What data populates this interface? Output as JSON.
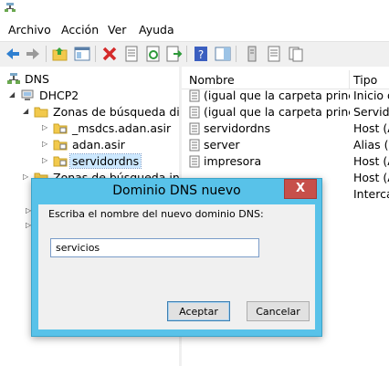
{
  "menu": [
    "Archivo",
    "Acción",
    "Ver",
    "Ayuda"
  ],
  "tree": {
    "root": "DNS",
    "server": "DHCP2",
    "forward_zones": "Zonas de búsqueda direc",
    "zones": [
      "_msdcs.adan.asir",
      "adan.asir",
      "servidordns"
    ],
    "reverse_zones": "Zonas de búsqueda inve"
  },
  "list": {
    "headers": {
      "name": "Nombre",
      "type": "Tipo"
    },
    "rows": [
      {
        "name": "(igual que la carpeta princip...",
        "type": "Inicio d"
      },
      {
        "name": "(igual que la carpeta princip...",
        "type": "Servido"
      },
      {
        "name": "servidordns",
        "type": "Host (A"
      },
      {
        "name": "server",
        "type": "Alias (C"
      },
      {
        "name": "impresora",
        "type": "Host (A"
      },
      {
        "name": "",
        "type": "Host (A"
      },
      {
        "name": "",
        "type": "Intercar"
      }
    ]
  },
  "dialog": {
    "title": "Dominio DNS nuevo",
    "close_glyph": "X",
    "prompt": "Escriba el nombre del nuevo dominio DNS:",
    "input_value": "servicios",
    "ok_label": "Aceptar",
    "cancel_label": "Cancelar"
  },
  "colors": {
    "dialog_frame": "#58c2e9",
    "close_button": "#c7504a",
    "selection": "#cce8ff",
    "folder": "#f2c94c"
  }
}
